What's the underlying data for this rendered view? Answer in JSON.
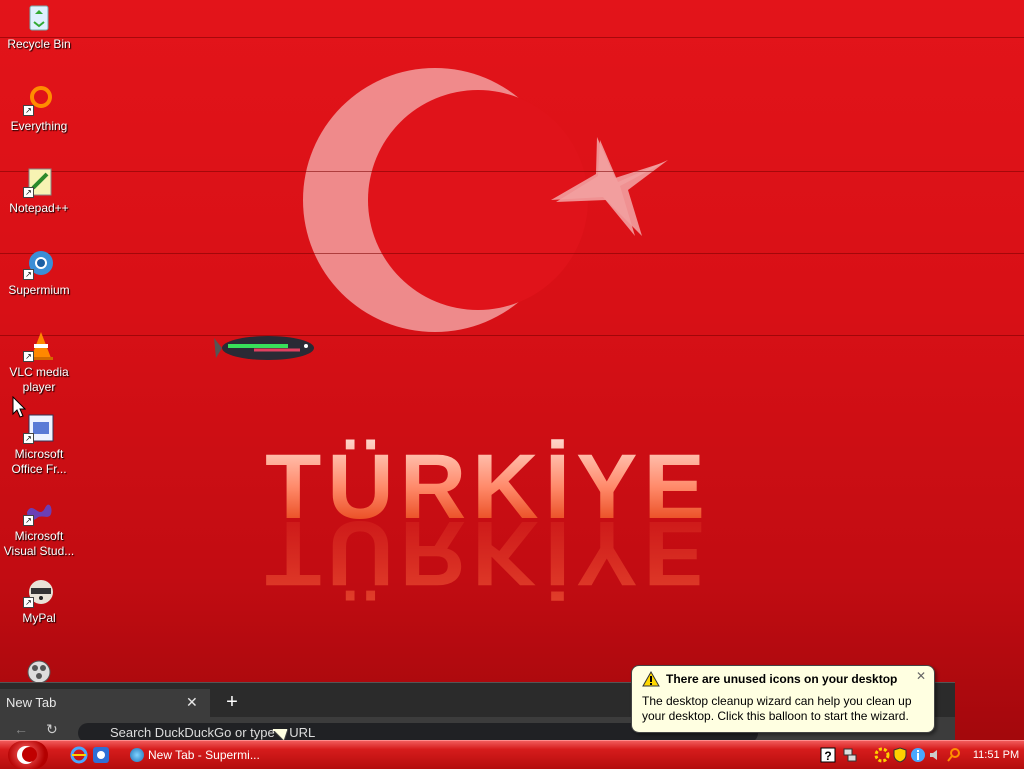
{
  "desktop": {
    "icons": [
      {
        "label": "Recycle Bin",
        "icon": "recycle-bin-icon"
      },
      {
        "label": "Everything",
        "icon": "everything-search-icon"
      },
      {
        "label": "Notepad++",
        "icon": "notepad-plus-plus-icon"
      },
      {
        "label": "Supermium",
        "icon": "supermium-browser-icon"
      },
      {
        "label": "VLC media player",
        "icon": "vlc-cone-icon"
      },
      {
        "label": "Microsoft Office Fr...",
        "icon": "office-frontpage-icon"
      },
      {
        "label": "Microsoft Visual Stud...",
        "icon": "visual-studio-icon"
      },
      {
        "label": "MyPal",
        "icon": "mypal-raccoon-icon"
      }
    ],
    "wallpaper_text": "TÜRKİYE"
  },
  "browser": {
    "tab_title": "New Tab",
    "close_glyph": "✕",
    "newtab_glyph": "+",
    "omnibox_placeholder": "Search DuckDuckGo or type a URL"
  },
  "balloon": {
    "title": "There are unused icons on your desktop",
    "text": "The desktop cleanup wizard can help you clean up your desktop. Click this balloon to start the wizard.",
    "close_glyph": "✕"
  },
  "taskbar": {
    "task_label": "New Tab - Supermi...",
    "clock": "11:51 PM"
  }
}
